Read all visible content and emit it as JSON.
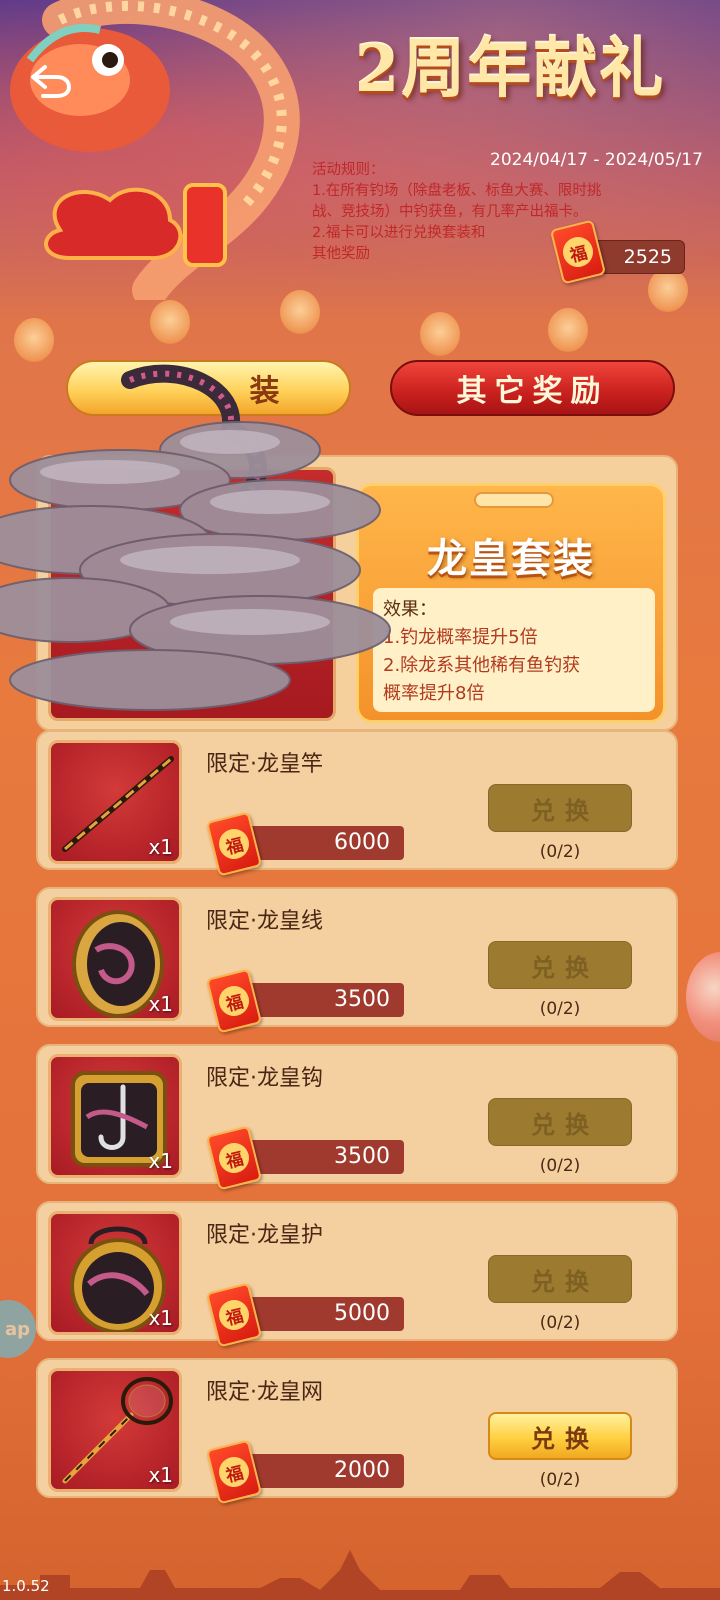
{
  "header": {
    "title": "2周年献礼",
    "date_range": "2024/04/17 - 2024/05/17",
    "rules": [
      "活动规则：",
      "1.在所有钓场（除盘老板、标鱼大赛、限时挑",
      "  战、竞技场）中钓获鱼，有几率产出福卡。",
      "2.福卡可以进行兑换套装和",
      "  其他奖励"
    ],
    "fu_count": "2525",
    "fu_glyph": "福"
  },
  "tabs": {
    "suit_label": "装",
    "other_label": "其它奖励"
  },
  "suit": {
    "name": "龙皇套装",
    "effect_heading": "效果：",
    "effects": [
      "1.钓龙概率提升5倍",
      "2.除龙系其他稀有鱼钓获",
      "概率提升8倍"
    ]
  },
  "items": [
    {
      "name": "限定·龙皇竿",
      "qty": "x1",
      "price": "6000",
      "button": "兑换",
      "count": "(0/2)",
      "enabled": false,
      "icon": "fishing-rod-icon"
    },
    {
      "name": "限定·龙皇线",
      "qty": "x1",
      "price": "3500",
      "button": "兑换",
      "count": "(0/2)",
      "enabled": false,
      "icon": "fishing-line-reel-icon"
    },
    {
      "name": "限定·龙皇钩",
      "qty": "x1",
      "price": "3500",
      "button": "兑换",
      "count": "(0/2)",
      "enabled": false,
      "icon": "fishing-hook-icon"
    },
    {
      "name": "限定·龙皇护",
      "qty": "x1",
      "price": "5000",
      "button": "兑换",
      "count": "(0/2)",
      "enabled": false,
      "icon": "protector-bag-icon"
    },
    {
      "name": "限定·龙皇网",
      "qty": "x1",
      "price": "2000",
      "button": "兑换",
      "count": "(0/2)",
      "enabled": true,
      "icon": "landing-net-icon"
    }
  ],
  "footer": {
    "version": "1.0.52",
    "side_tab": "ap"
  },
  "colors": {
    "accent_gold": "#ffd040",
    "accent_red": "#c8201e",
    "disabled_button": "#9c7a30"
  }
}
